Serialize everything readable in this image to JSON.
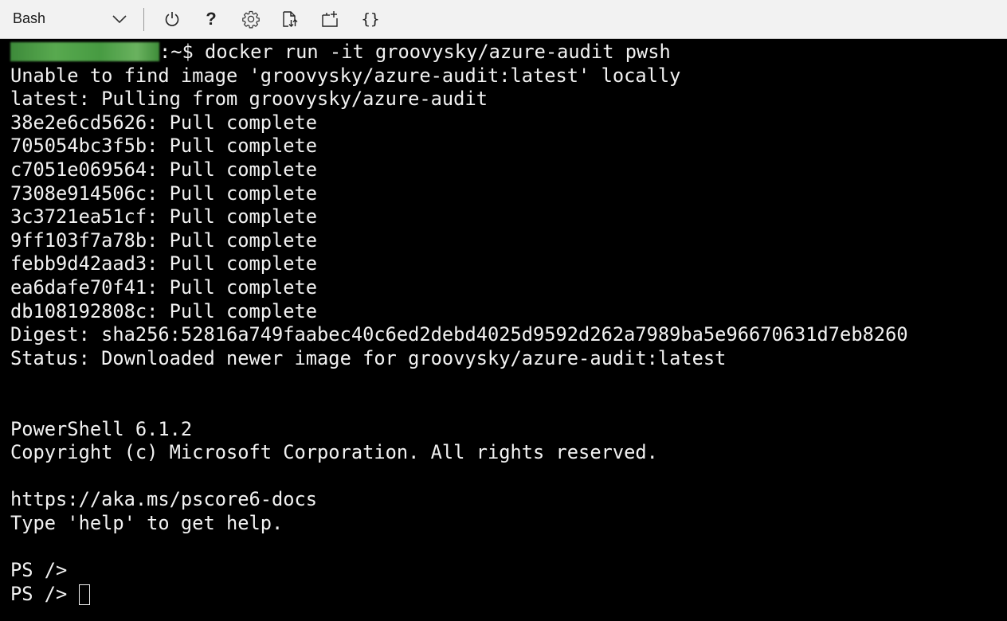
{
  "toolbar": {
    "shell_selector": {
      "value": "Bash",
      "icon": "chevron-down-icon"
    },
    "icons": [
      {
        "name": "power-icon"
      },
      {
        "name": "help-icon",
        "glyph": "?"
      },
      {
        "name": "settings-icon"
      },
      {
        "name": "upload-download-icon"
      },
      {
        "name": "new-session-icon"
      },
      {
        "name": "editor-braces-icon",
        "glyph": "{}"
      }
    ]
  },
  "terminal": {
    "prompt_user_redacted": true,
    "prompt_suffix": ":~$",
    "command": " docker run -it groovysky/azure-audit pwsh",
    "output": [
      "Unable to find image 'groovysky/azure-audit:latest' locally",
      "latest: Pulling from groovysky/azure-audit",
      "38e2e6cd5626: Pull complete",
      "705054bc3f5b: Pull complete",
      "c7051e069564: Pull complete",
      "7308e914506c: Pull complete",
      "3c3721ea51cf: Pull complete",
      "9ff103f7a78b: Pull complete",
      "febb9d42aad3: Pull complete",
      "ea6dafe70f41: Pull complete",
      "db108192808c: Pull complete",
      "Digest: sha256:52816a749faabec40c6ed2debd4025d9592d262a7989ba5e96670631d7eb8260",
      "Status: Downloaded newer image for groovysky/azure-audit:latest",
      "",
      "",
      "PowerShell 6.1.2",
      "Copyright (c) Microsoft Corporation. All rights reserved.",
      "",
      "https://aka.ms/pscore6-docs",
      "Type 'help' to get help.",
      "",
      "PS />"
    ],
    "current_prompt": "PS /> "
  },
  "colors": {
    "toolbar_bg": "#f2f2f2",
    "terminal_bg": "#000000",
    "terminal_fg": "#f2f2f2"
  }
}
